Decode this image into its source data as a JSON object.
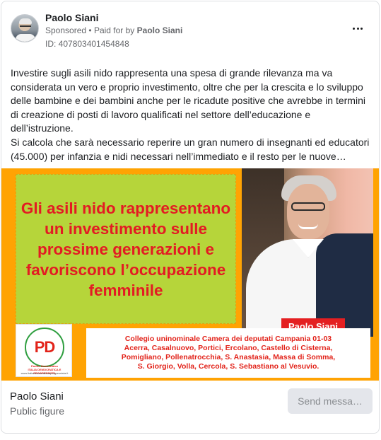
{
  "header": {
    "page_name": "Paolo Siani",
    "sponsored_label": "Sponsored",
    "separator": "•",
    "paid_for_prefix": "Paid for by",
    "paid_for_name": "Paolo Siani",
    "ad_id": "ID: 407803401454848",
    "more_icon": "more-horizontal-icon"
  },
  "body": {
    "paragraphs": [
      "Investire sugli asili nido rappresenta una spesa di grande rilevanza ma va considerata un vero e proprio investimento, oltre che per la crescita e lo sviluppo delle bambine e dei bambini anche per le ricadute positive che avrebbe in termini di creazione di posti di lavoro qualificati nel settore dell’educazione e dell’istruzione.",
      "Si calcola che sarà necessario reperire un gran numero di insegnanti ed educatori (45.000) per infanzia e nidi necessari nell’immediato e il resto per le nuove…"
    ]
  },
  "creative": {
    "headline_lines": [
      "Gli asili nido rappresentano",
      "un investimento sulle",
      "prossime generazioni e",
      "favoriscono l’occupazione",
      "femminile"
    ],
    "name_tag": "Paolo Siani",
    "logo_text_pd": "PD",
    "logo_sub": "Partito Democratico",
    "logo_sub2": "ITALIA DEMOCRATICA E PROGRESSISTA",
    "logo_url": "www.italiademocraticaeprogressista.it",
    "info_title": "Collegio uninominale Camera dei deputati Campania 01-03",
    "info_lines": [
      "Acerra, Casalnuovo, Portici, Ercolano, Castello di Cisterna,",
      "Pomigliano, Pollenatrocchia, S. Anastasia, Massa di Somma,",
      "S. Giorgio, Volla, Cercola, S. Sebastiano al Vesuvio."
    ],
    "colors": {
      "background": "#ffa303",
      "green_box": "#b6d53a",
      "headline": "#e31b23",
      "name_tag": "#e41f21"
    }
  },
  "footer": {
    "name": "Paolo Siani",
    "subtitle": "Public figure",
    "button_label": "Send messa…"
  }
}
